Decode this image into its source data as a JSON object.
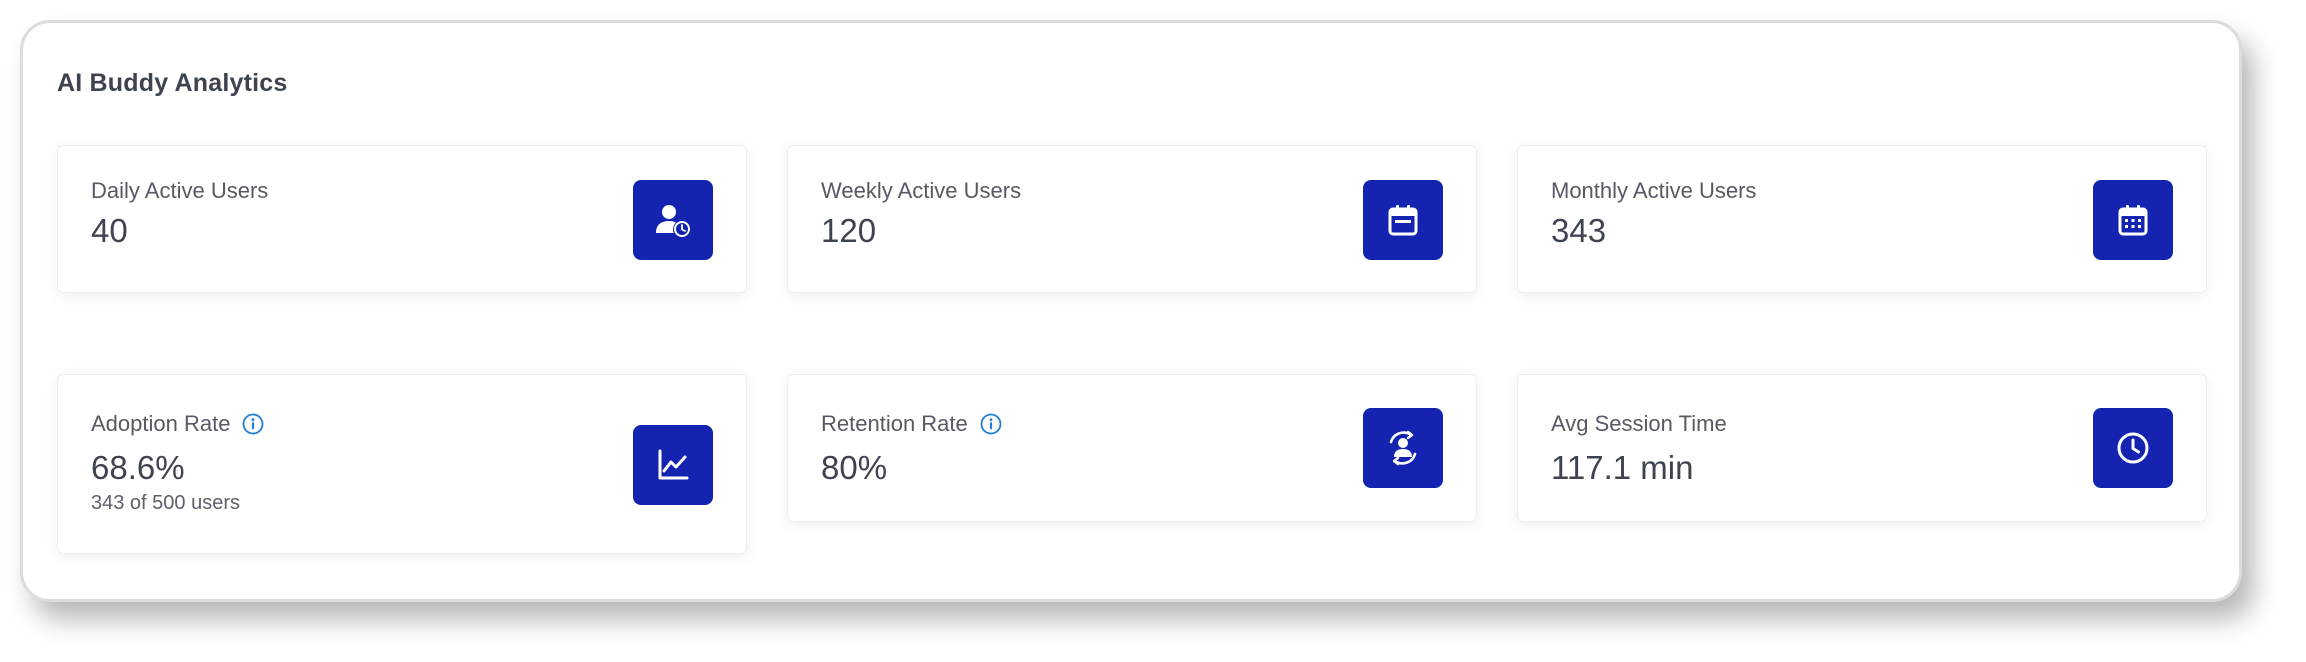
{
  "panel": {
    "title": "AI Buddy Analytics"
  },
  "cards": {
    "daily": {
      "label": "Daily Active Users",
      "value": "40",
      "icon": "user-clock-icon"
    },
    "weekly": {
      "label": "Weekly Active Users",
      "value": "120",
      "icon": "calendar-week-icon"
    },
    "monthly": {
      "label": "Monthly Active Users",
      "value": "343",
      "icon": "calendar-month-icon"
    },
    "adoption": {
      "label": "Adoption Rate",
      "value": "68.6%",
      "sub": "343 of 500 users",
      "icon": "line-chart-icon",
      "info_icon": "info-icon"
    },
    "retention": {
      "label": "Retention Rate",
      "value": "80%",
      "icon": "user-cycle-icon",
      "info_icon": "info-icon"
    },
    "session": {
      "label": "Avg Session Time",
      "value": "117.1 min",
      "icon": "clock-icon"
    }
  },
  "colors": {
    "accent": "#1424b0",
    "info": "#1f7fd6",
    "text": "#3e4350"
  }
}
